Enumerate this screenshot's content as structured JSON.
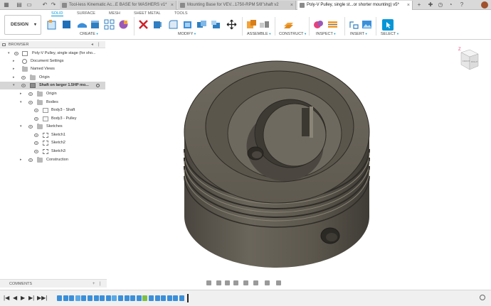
{
  "tabs": {
    "items": [
      {
        "label": "Tool-less Kinematic Ac...E BASE for WASHERS v1*",
        "active": false
      },
      {
        "label": "Mounting Base for VEV...1750-RPM 5/8\"shaft v2",
        "active": false
      },
      {
        "label": "Poly-V Pulley, single st...or shorter mounting) v5*",
        "active": true
      }
    ],
    "close": "×",
    "add": "+"
  },
  "toolbar": {
    "workspace": "DESIGN",
    "caret": "▾",
    "workspace_tabs": [
      {
        "label": "SOLID",
        "active": true
      },
      {
        "label": "SURFACE",
        "active": false
      },
      {
        "label": "MESH",
        "active": false
      },
      {
        "label": "SHEET METAL",
        "active": false
      },
      {
        "label": "TOOLS",
        "active": false
      }
    ],
    "groups": [
      {
        "label": "CREATE"
      },
      {
        "label": "MODIFY"
      },
      {
        "label": "ASSEMBLE"
      },
      {
        "label": "CONSTRUCT"
      },
      {
        "label": "INSPECT"
      },
      {
        "label": "INSERT"
      },
      {
        "label": "SELECT"
      }
    ],
    "group_caret": "▾"
  },
  "browser": {
    "title": "BROWSER",
    "controls": [
      "◂",
      "|"
    ],
    "items": [
      {
        "label": "Poly-V Pulley, single stage (for sho...",
        "icon": "doc",
        "expanded": true
      },
      {
        "label": "Document Settings",
        "icon": "gear",
        "expanded": false
      },
      {
        "label": "Named Views",
        "icon": "folder",
        "expanded": false
      },
      {
        "label": "Origin",
        "icon": "folder",
        "expanded": false
      },
      {
        "label": "Shaft on larger 1.5HP mo...",
        "icon": "comp",
        "expanded": true,
        "highlight": true
      },
      {
        "label": "Origin",
        "icon": "folder",
        "expanded": false
      },
      {
        "label": "Bodies",
        "icon": "folder",
        "expanded": true
      },
      {
        "label": "Body3 - Shaft",
        "icon": "body",
        "expanded": false
      },
      {
        "label": "Body3 - Pulley",
        "icon": "body",
        "expanded": false
      },
      {
        "label": "Sketches",
        "icon": "folder",
        "expanded": true
      },
      {
        "label": "Sketch1",
        "icon": "sketch",
        "expanded": false
      },
      {
        "label": "Sketch2",
        "icon": "sketch",
        "expanded": false
      },
      {
        "label": "Sketch3",
        "icon": "sketch",
        "expanded": false
      },
      {
        "label": "Construction",
        "icon": "folder",
        "expanded": false
      }
    ]
  },
  "viewcube": {
    "front": "FRONT",
    "right": "RIGHT",
    "axis_z": "Z"
  },
  "comments": {
    "title": "COMMENTS",
    "controls": [
      "+",
      "|"
    ]
  },
  "timeline": {
    "controls": [
      "|◀",
      "◀",
      "▶",
      "▶|",
      "▶▶|"
    ],
    "item_colors": [
      "#3b8fd9",
      "#3b8fd9",
      "#3b8fd9",
      "#5aa9e6",
      "#3b8fd9",
      "#3b8fd9",
      "#3b8fd9",
      "#3b8fd9",
      "#3b8fd9",
      "#5aa9e6",
      "#3b8fd9",
      "#3b8fd9",
      "#3b8fd9",
      "#3b8fd9",
      "#7bbf4a",
      "#3b8fd9",
      "#3b8fd9",
      "#3b8fd9",
      "#3b8fd9",
      "#3b8fd9",
      "#3b8fd9"
    ]
  },
  "colors": {
    "accent": "#0696d7",
    "body": "#5a554b"
  }
}
